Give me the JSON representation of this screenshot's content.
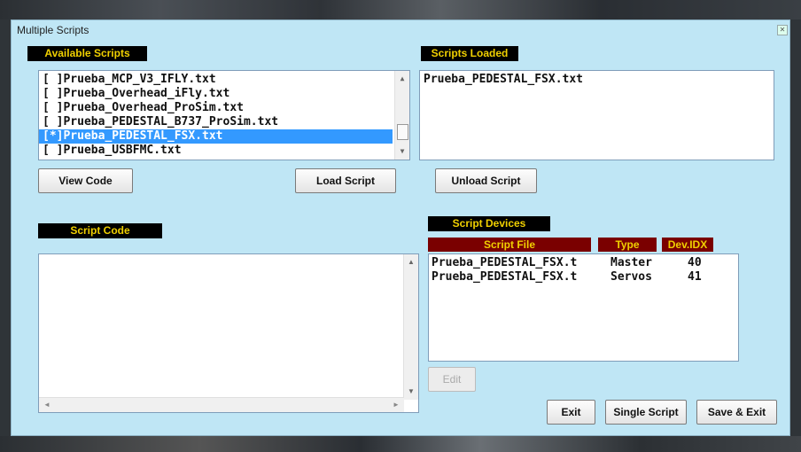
{
  "window": {
    "title": "Multiple Scripts",
    "close_icon": "close-icon"
  },
  "available": {
    "header": "Available Scripts",
    "items": [
      {
        "label": "[ ]Prueba_MCP_V3_IFLY.txt",
        "selected": false
      },
      {
        "label": "[ ]Prueba_Overhead_iFly.txt",
        "selected": false
      },
      {
        "label": "[ ]Prueba_Overhead_ProSim.txt",
        "selected": false
      },
      {
        "label": "[ ]Prueba_PEDESTAL_B737_ProSim.txt",
        "selected": false
      },
      {
        "label": "[*]Prueba_PEDESTAL_FSX.txt",
        "selected": true
      },
      {
        "label": "[ ]Prueba_USBFMC.txt",
        "selected": false
      }
    ]
  },
  "loaded": {
    "header": "Scripts Loaded",
    "items": [
      "Prueba_PEDESTAL_FSX.txt"
    ]
  },
  "code": {
    "header": "Script Code",
    "content": ""
  },
  "devices": {
    "header": "Script Devices",
    "columns": [
      "Script File",
      "Type",
      "Dev.IDX"
    ],
    "rows": [
      {
        "file": "Prueba_PEDESTAL_FSX.t",
        "type": "Master",
        "idx": "40"
      },
      {
        "file": "Prueba_PEDESTAL_FSX.t",
        "type": "Servos",
        "idx": "41"
      }
    ]
  },
  "buttons": {
    "view_code": "View Code",
    "load_script": "Load Script",
    "unload_script": "Unload Script",
    "edit": "Edit",
    "exit": "Exit",
    "single_script": "Single Script",
    "save_exit": "Save & Exit"
  },
  "colors": {
    "background": "#bfe6f5",
    "header_bg": "#000000",
    "header_text": "#f0d000",
    "devices_header_bg": "#7a0000",
    "selection": "#3399ff"
  }
}
